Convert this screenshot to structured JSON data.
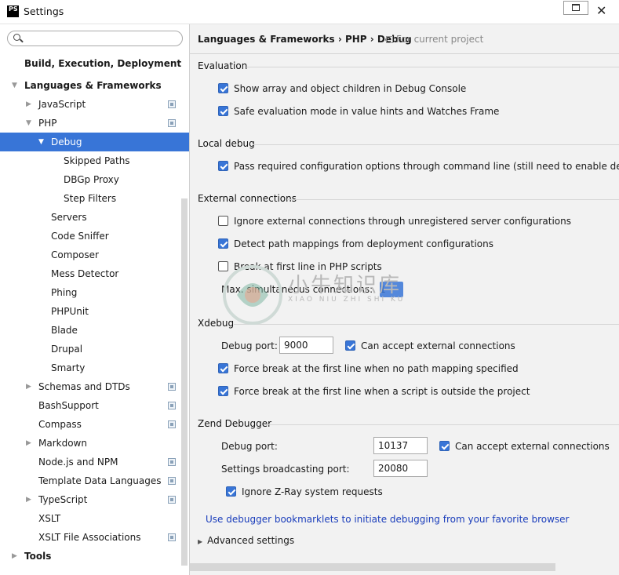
{
  "window": {
    "title": "Settings",
    "app_icon": "PS"
  },
  "search": {
    "placeholder": ""
  },
  "tree": [
    {
      "label": "Build, Execution, Deployment",
      "level": 0,
      "bold": true,
      "arrow": ""
    },
    {
      "label": "Languages & Frameworks",
      "level": 0,
      "bold": true,
      "arrow": "expanded"
    },
    {
      "label": "JavaScript",
      "level": 1,
      "arrow": "collapsed",
      "project_icon": true
    },
    {
      "label": "PHP",
      "level": 1,
      "arrow": "expanded",
      "project_icon": true
    },
    {
      "label": "Debug",
      "level": 2,
      "arrow": "expanded",
      "selected": true
    },
    {
      "label": "Skipped Paths",
      "level": 3
    },
    {
      "label": "DBGp Proxy",
      "level": 3
    },
    {
      "label": "Step Filters",
      "level": 3
    },
    {
      "label": "Servers",
      "level": 2
    },
    {
      "label": "Code Sniffer",
      "level": 2
    },
    {
      "label": "Composer",
      "level": 2
    },
    {
      "label": "Mess Detector",
      "level": 2
    },
    {
      "label": "Phing",
      "level": 2
    },
    {
      "label": "PHPUnit",
      "level": 2
    },
    {
      "label": "Blade",
      "level": 2
    },
    {
      "label": "Drupal",
      "level": 2
    },
    {
      "label": "Smarty",
      "level": 2
    },
    {
      "label": "Schemas and DTDs",
      "level": 1,
      "arrow": "collapsed",
      "project_icon": true
    },
    {
      "label": "BashSupport",
      "level": 1,
      "project_icon": true
    },
    {
      "label": "Compass",
      "level": 1,
      "project_icon": true
    },
    {
      "label": "Markdown",
      "level": 1,
      "arrow": "collapsed"
    },
    {
      "label": "Node.js and NPM",
      "level": 1,
      "project_icon": true
    },
    {
      "label": "Template Data Languages",
      "level": 1,
      "project_icon": true
    },
    {
      "label": "TypeScript",
      "level": 1,
      "arrow": "collapsed",
      "project_icon": true
    },
    {
      "label": "XSLT",
      "level": 1
    },
    {
      "label": "XSLT File Associations",
      "level": 1,
      "project_icon": true
    },
    {
      "label": "Tools",
      "level": 0,
      "bold": true,
      "arrow": "collapsed"
    }
  ],
  "breadcrumb": {
    "path": "Languages & Frameworks › PHP › Debug",
    "note": "For current project"
  },
  "evaluation": {
    "title": "Evaluation",
    "show_array": {
      "label": "Show array and object children in Debug Console",
      "checked": true
    },
    "safe_eval": {
      "label": "Safe evaluation mode in value hints and Watches Frame",
      "checked": true
    }
  },
  "local_debug": {
    "title": "Local debug",
    "pass_config": {
      "label": "Pass required configuration options through command line (still need to enable debug exten",
      "checked": true
    }
  },
  "external": {
    "title": "External connections",
    "ignore_external": {
      "label": "Ignore external connections through unregistered server configurations",
      "checked": false
    },
    "detect_path": {
      "label": "Detect path mappings from deployment configurations",
      "checked": true
    },
    "break_first": {
      "label": "Break at first line in PHP scripts",
      "checked": false
    },
    "max_conn_label": "Max. simultaneous connections:",
    "max_conn_value": "1"
  },
  "xdebug": {
    "title": "Xdebug",
    "port_label": "Debug port:",
    "port_value": "9000",
    "accept_external": {
      "label": "Can accept external connections",
      "checked": true
    },
    "force_no_mapping": {
      "label": "Force break at the first line when no path mapping specified",
      "checked": true
    },
    "force_outside": {
      "label": "Force break at the first line when a script is outside the project",
      "checked": true
    }
  },
  "zend": {
    "title": "Zend Debugger",
    "port_label": "Debug port:",
    "port_value": "10137",
    "accept_external": {
      "label": "Can accept external connections",
      "checked": true
    },
    "broadcast_label": "Settings broadcasting port:",
    "broadcast_value": "20080",
    "ignore_zray": {
      "label": "Ignore Z-Ray system requests",
      "checked": true
    }
  },
  "bookmarklets_link": "Use debugger bookmarklets to initiate debugging from your favorite browser",
  "advanced": "Advanced settings",
  "watermark": {
    "text": "小牛知识库",
    "sub": "XIAO NIU ZHI SHI KU"
  }
}
